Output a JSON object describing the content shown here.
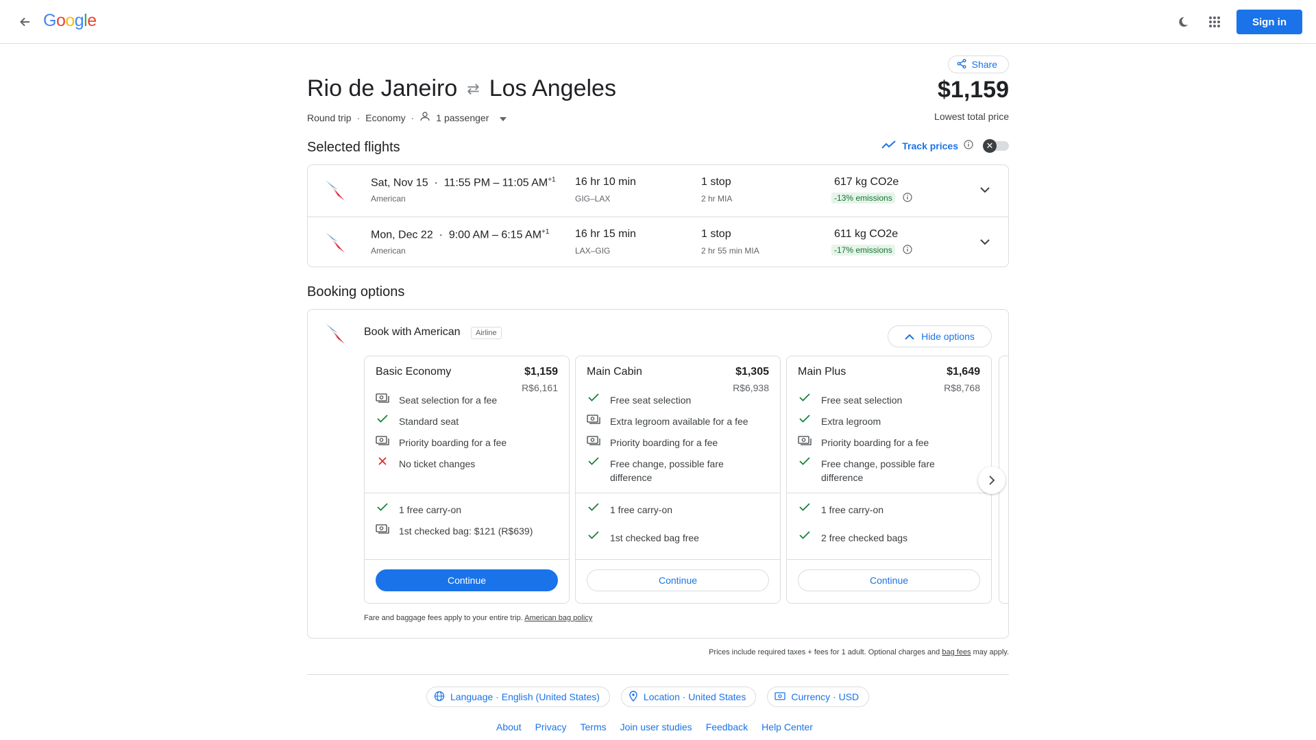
{
  "header": {
    "logo_letters": [
      "G",
      "o",
      "o",
      "g",
      "l",
      "e"
    ],
    "signin_label": "Sign in"
  },
  "trip": {
    "origin": "Rio de Janeiro",
    "destination": "Los Angeles",
    "trip_type": "Round trip",
    "cabin": "Economy",
    "passengers": "1 passenger",
    "price": "$1,159",
    "price_label": "Lowest total price",
    "share_label": "Share"
  },
  "selected_flights": {
    "title": "Selected flights",
    "track_label": "Track prices",
    "flights": [
      {
        "date": "Sat, Nov 15",
        "times": "11:55 PM – 11:05 AM",
        "plus_day": "+1",
        "airline": "American",
        "duration": "16 hr 10 min",
        "route": "GIG–LAX",
        "stops": "1 stop",
        "layover": "2 hr MIA",
        "co2": "617 kg CO2e",
        "emissions": "-13% emissions"
      },
      {
        "date": "Mon, Dec 22",
        "times": "9:00 AM – 6:15 AM",
        "plus_day": "+1",
        "airline": "American",
        "duration": "16 hr 15 min",
        "route": "LAX–GIG",
        "stops": "1 stop",
        "layover": "2 hr 55 min MIA",
        "co2": "611 kg CO2e",
        "emissions": "-17% emissions"
      }
    ]
  },
  "booking": {
    "title": "Booking options",
    "book_with": "Book with American",
    "tag": "Airline",
    "hide_label": "Hide options",
    "fares": [
      {
        "name": "Basic Economy",
        "price": "$1,159",
        "local": "R$6,161",
        "features": [
          {
            "icon": "fee-icon",
            "text": "Seat selection for a fee"
          },
          {
            "icon": "check-icon",
            "text": "Standard seat"
          },
          {
            "icon": "fee-icon",
            "text": "Priority boarding for a fee"
          },
          {
            "icon": "cross-icon",
            "text": "No ticket changes"
          }
        ],
        "bags": [
          {
            "icon": "check-icon",
            "text": "1 free carry-on"
          },
          {
            "icon": "fee-icon",
            "text": "1st checked bag: $121 (R$639)"
          }
        ],
        "button": "Continue"
      },
      {
        "name": "Main Cabin",
        "price": "$1,305",
        "local": "R$6,938",
        "features": [
          {
            "icon": "check-icon",
            "text": "Free seat selection"
          },
          {
            "icon": "fee-icon",
            "text": "Extra legroom available for a fee"
          },
          {
            "icon": "fee-icon",
            "text": "Priority boarding for a fee"
          },
          {
            "icon": "check-icon",
            "text": "Free change, possible fare difference"
          }
        ],
        "bags": [
          {
            "icon": "check-icon",
            "text": "1 free carry-on"
          },
          {
            "icon": "check-icon",
            "text": "1st checked bag free"
          }
        ],
        "button": "Continue"
      },
      {
        "name": "Main Plus",
        "price": "$1,649",
        "local": "R$8,768",
        "features": [
          {
            "icon": "check-icon",
            "text": "Free seat selection"
          },
          {
            "icon": "check-icon",
            "text": "Extra legroom"
          },
          {
            "icon": "fee-icon",
            "text": "Priority boarding for a fee"
          },
          {
            "icon": "check-icon",
            "text": "Free change, possible fare difference"
          }
        ],
        "bags": [
          {
            "icon": "check-icon",
            "text": "1 free carry-on"
          },
          {
            "icon": "check-icon",
            "text": "2 free checked bags"
          }
        ],
        "button": "Continue"
      }
    ],
    "fees_note": "Fare and baggage fees apply to your entire trip.",
    "bag_policy_link": "American bag policy"
  },
  "taxes_note": "Prices include required taxes + fees for 1 adult. Optional charges and",
  "taxes_link": "bag fees",
  "taxes_tail": "may apply.",
  "footer": {
    "language": "Language · English (United States)",
    "location": "Location · United States",
    "currency": "Currency · USD",
    "links": [
      "About",
      "Privacy",
      "Terms",
      "Join user studies",
      "Feedback",
      "Help Center"
    ]
  },
  "colors": {
    "accent": "#1a73e8",
    "check": "#188038",
    "cross": "#d93025",
    "emissions_bg": "#e6f4ea"
  }
}
